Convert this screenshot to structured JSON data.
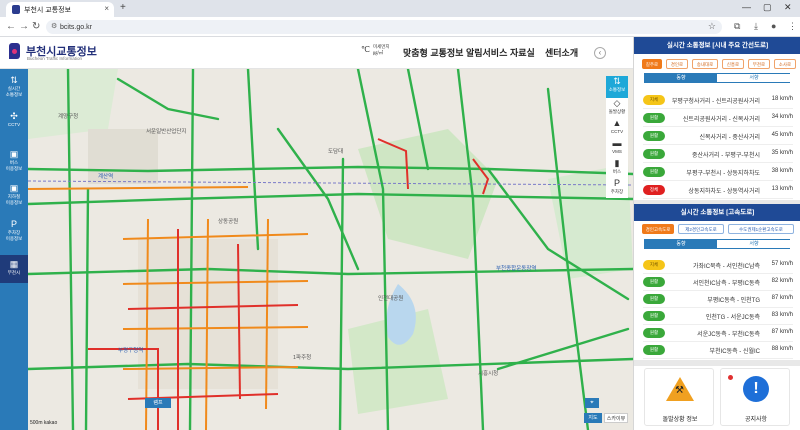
{
  "browser": {
    "tab_title": "부천시 교통정보",
    "url": "bcits.go.kr"
  },
  "header": {
    "logo_title": "부천시교통정보",
    "logo_sub": "Bucheon Traffic Information",
    "weather_temp": "℃",
    "weather_dust_label": "미세먼지",
    "weather_dust_unit": "㎍/㎥",
    "menu": [
      "맞춤형 교통정보 알림서비스",
      "자료실",
      "센터소개"
    ]
  },
  "sidenav": [
    {
      "icon": "updown-arrow-icon",
      "glyph": "⇅",
      "label1": "실시간",
      "label2": "소통정보"
    },
    {
      "icon": "cctv-icon",
      "glyph": "✣",
      "label1": "CCTV",
      "label2": ""
    },
    {
      "icon": "bus-icon",
      "glyph": "▣",
      "label1": "버스",
      "label2": "이용정보"
    },
    {
      "icon": "subway-icon",
      "glyph": "▣",
      "label1": "지하철",
      "label2": "이용정보"
    },
    {
      "icon": "parking-icon",
      "glyph": "P",
      "label1": "주차장",
      "label2": "이용정보"
    },
    {
      "icon": "city-icon",
      "glyph": "▦",
      "label1": "부천시",
      "label2": "",
      "active": true
    }
  ],
  "map_tools": [
    {
      "icon": "traffic-icon",
      "glyph": "⇅",
      "label": "소통정보",
      "active": true
    },
    {
      "icon": "incident-icon",
      "glyph": "◇",
      "label": "돌발상황"
    },
    {
      "icon": "cctv-icon",
      "glyph": "▲",
      "label": "CCTV"
    },
    {
      "icon": "vms-icon",
      "glyph": "▬",
      "label": "VMS"
    },
    {
      "icon": "bus-stop-icon",
      "glyph": "▮",
      "label": "버스"
    },
    {
      "icon": "parking-icon",
      "glyph": "P",
      "label": "주차장"
    }
  ],
  "map_labels": [
    {
      "t": "계양구청",
      "blue": false
    },
    {
      "t": "계산역",
      "blue": true
    },
    {
      "t": "부평구청역",
      "blue": true
    },
    {
      "t": "서운일반산업단지",
      "blue": false
    },
    {
      "t": "도담대",
      "blue": false
    },
    {
      "t": "인천대공원",
      "blue": false
    },
    {
      "t": "1파주청",
      "blue": false
    },
    {
      "t": "시흥시청",
      "blue": false
    },
    {
      "t": "상동공원",
      "blue": false
    },
    {
      "t": "부천종합운동장역",
      "blue": true
    }
  ],
  "map_controls": {
    "ramp": "램프",
    "pin": "지도",
    "map": "지도",
    "sky": "스카이뷰",
    "scale": "500m",
    "brand": "kakao"
  },
  "panel_arterial": {
    "title": "실시간 소통정보 [시내 주요 간선도로]",
    "chips": [
      "길주로",
      "경인로",
      "송내대로",
      "신흥로",
      "부천로",
      "소사로"
    ],
    "active_chip": 0,
    "dir_on": "동향",
    "dir_off": "서향",
    "rows": [
      {
        "status": "지체",
        "cls": "b-yellow",
        "road": "부평구청사거리 - 신트리공원사거리",
        "speed": "18 km/h"
      },
      {
        "status": "원활",
        "cls": "b-green",
        "road": "신트리공원사거리 - 신복사거리",
        "speed": "34 km/h"
      },
      {
        "status": "원활",
        "cls": "b-green",
        "road": "신복사거리 - 중산사거리",
        "speed": "45 km/h"
      },
      {
        "status": "원활",
        "cls": "b-green",
        "road": "중산사거리 - 부평구-부천시",
        "speed": "35 km/h"
      },
      {
        "status": "원활",
        "cls": "b-green",
        "road": "부평구-부천시 - 상동지하차도",
        "speed": "38 km/h"
      },
      {
        "status": "정체",
        "cls": "b-red",
        "road": "상동지하차도 - 상동역사거리",
        "speed": "13 km/h"
      }
    ]
  },
  "panel_highway": {
    "title": "실시간 소통정보 [고속도로]",
    "chips": [
      "경인고속도로",
      "제2경인고속도로",
      "수도권제1순환고속도로"
    ],
    "active_chip": 0,
    "dir_on": "동향",
    "dir_off": "서향",
    "rows": [
      {
        "status": "지체",
        "cls": "b-yellow",
        "road": "가좌IC북측 - 서인천IC남측",
        "speed": "57 km/h"
      },
      {
        "status": "원활",
        "cls": "b-green",
        "road": "서인천IC남측 - 부평IC동측",
        "speed": "82 km/h"
      },
      {
        "status": "원활",
        "cls": "b-green",
        "road": "부평IC동측 - 인천TG",
        "speed": "87 km/h"
      },
      {
        "status": "원활",
        "cls": "b-green",
        "road": "인천TG - 서운JC동측",
        "speed": "83 km/h"
      },
      {
        "status": "원활",
        "cls": "b-green",
        "road": "서운JC동측 - 부천IC동측",
        "speed": "87 km/h"
      },
      {
        "status": "원활",
        "cls": "b-green",
        "road": "부천IC동측 - 신월IC",
        "speed": "88 km/h"
      }
    ]
  },
  "cards": [
    {
      "label": "돌발상황 정보",
      "icon": "construction-warning-icon"
    },
    {
      "label": "공지사항",
      "icon": "exclamation-icon"
    }
  ],
  "colors": {
    "accent": "#2a7ab8",
    "panel_head": "#1f4a96",
    "green": "#3aa83a",
    "yellow": "#f5c518",
    "red": "#e02020",
    "orange": "#f07a1a"
  }
}
